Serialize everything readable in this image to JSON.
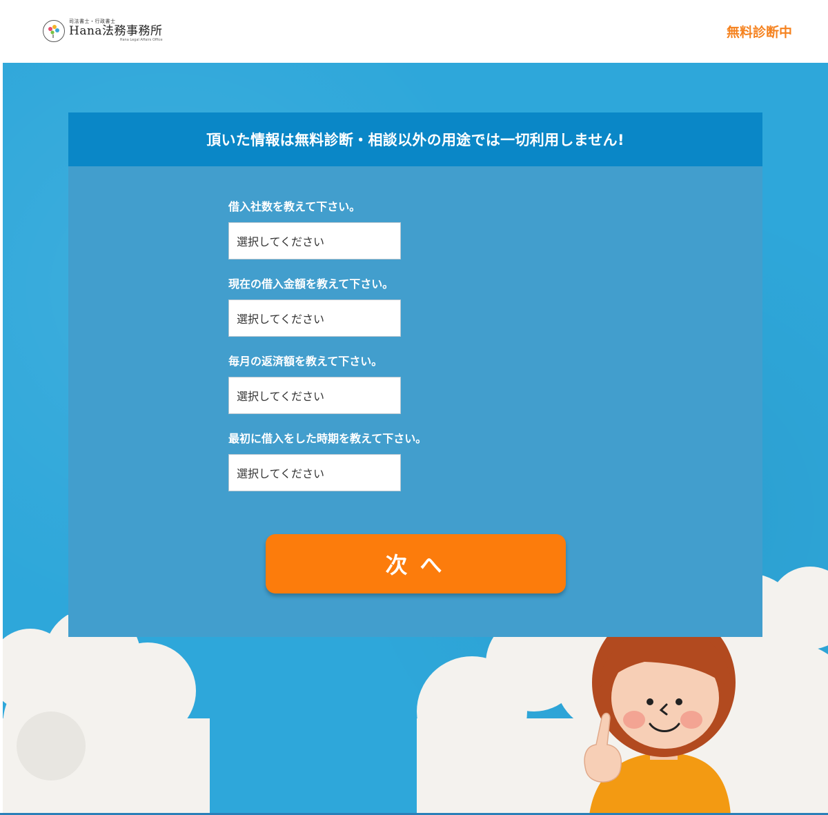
{
  "header": {
    "logo_sub": "司法書士・行政書士",
    "logo_name": "Hana法務事務所",
    "logo_en": "Hana Legal Affairs Office",
    "cta_label": "無料診断中"
  },
  "card": {
    "title": "頂いた情報は無料診断・相談以外の用途では一切利用しません!",
    "fields": [
      {
        "label": "借入社数を教えて下さい。",
        "value": "選択してください"
      },
      {
        "label": "現在の借入金額を教えて下さい。",
        "value": "選択してください"
      },
      {
        "label": "毎月の返済額を教えて下さい。",
        "value": "選択してください"
      },
      {
        "label": "最初に借入をした時期を教えて下さい。",
        "value": "選択してください"
      }
    ],
    "next_label": "次へ"
  },
  "colors": {
    "sky": "#2ea7da",
    "card": "#429ecd",
    "card_header": "#0a87c7",
    "accent_orange": "#fc7c0c",
    "cta_text": "#f5821f"
  }
}
